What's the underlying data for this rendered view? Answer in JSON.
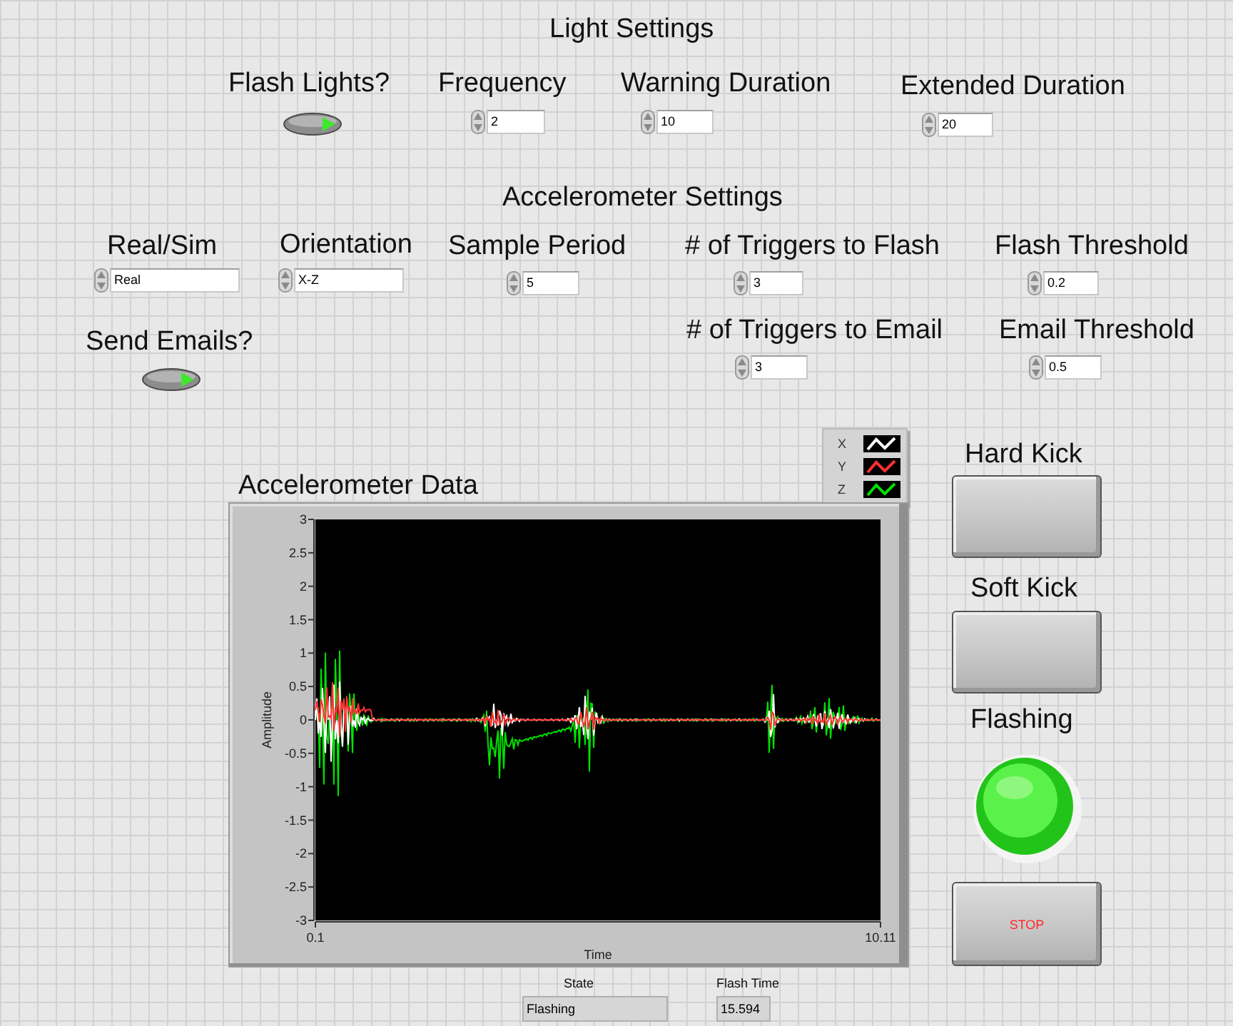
{
  "sections": [
    {
      "title": "Light Settings"
    },
    {
      "title": "Accelerometer Settings"
    }
  ],
  "controls": [
    {
      "kind": "toggle",
      "label": "Flash Lights?",
      "on": true
    },
    {
      "kind": "numeric",
      "label": "Frequency",
      "value": "2"
    },
    {
      "kind": "numeric",
      "label": "Warning Duration",
      "value": "10"
    },
    {
      "kind": "numeric",
      "label": "Extended Duration",
      "value": "20"
    },
    {
      "kind": "numeric",
      "label": "Real/Sim",
      "value": "Real"
    },
    {
      "kind": "numeric",
      "label": "Orientation",
      "value": "X-Z"
    },
    {
      "kind": "numeric",
      "label": "Sample Period",
      "value": "5"
    },
    {
      "kind": "numeric",
      "label": "# of Triggers to Flash",
      "value": "3"
    },
    {
      "kind": "numeric",
      "label": "Flash Threshold",
      "value": "0.2"
    },
    {
      "kind": "toggle",
      "label": "Send Emails?",
      "on": true
    },
    {
      "kind": "numeric",
      "label": "# of Triggers to Email",
      "value": "3"
    },
    {
      "kind": "numeric",
      "label": "Email Threshold",
      "value": "0.5"
    },
    {
      "kind": "button",
      "label": "Hard Kick"
    },
    {
      "kind": "button",
      "label": "Soft Kick"
    },
    {
      "kind": "led",
      "label": "Flashing",
      "on": true
    },
    {
      "kind": "stop",
      "text": "STOP"
    },
    {
      "kind": "indicator",
      "label": "State",
      "value": "Flashing"
    },
    {
      "kind": "indicator",
      "label": "Flash Time",
      "value": "15.594"
    }
  ],
  "graph": {
    "title": "Accelerometer Data",
    "ylabel": "Amplitude",
    "xlabel": "Time",
    "yticks": [
      "3",
      "2.5",
      "2",
      "1.5",
      "1",
      "0.5",
      "0",
      "-0.5",
      "-1",
      "-1.5",
      "-2",
      "-2.5",
      "-3"
    ],
    "xticks": [
      "0.1",
      "10.11"
    ],
    "legend": [
      {
        "name": "X",
        "color": "#ffffff"
      },
      {
        "name": "Y",
        "color": "#ff3030"
      },
      {
        "name": "Z",
        "color": "#00e000"
      }
    ]
  }
}
